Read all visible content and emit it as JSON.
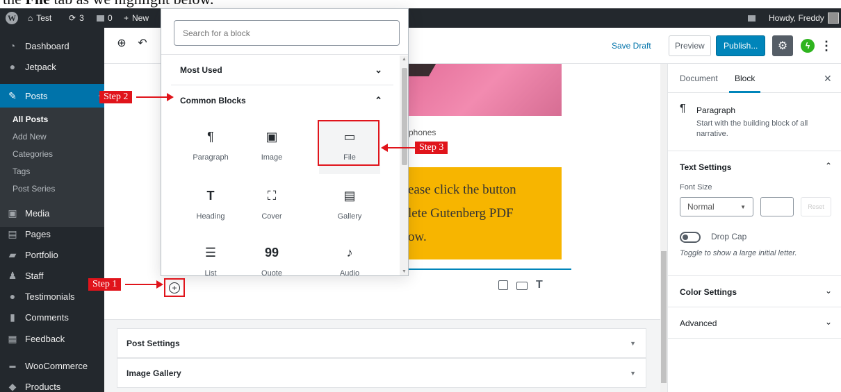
{
  "caption": {
    "prefix": "the ",
    "bold": "File",
    "suffix": " tab as we highlight below."
  },
  "adminbar": {
    "site_name": "Test",
    "updates_count": "3",
    "comments_count": "0",
    "new_label": "New",
    "howdy": "Howdy, Freddy"
  },
  "sidebar": {
    "items": [
      {
        "label": "Dashboard",
        "icon": "dashboard-icon"
      },
      {
        "label": "Jetpack",
        "icon": "jetpack-icon"
      },
      {
        "label": "Posts",
        "icon": "pin-icon"
      },
      {
        "label": "Media",
        "icon": "media-icon"
      },
      {
        "label": "Pages",
        "icon": "pages-icon"
      },
      {
        "label": "Portfolio",
        "icon": "portfolio-icon"
      },
      {
        "label": "Staff",
        "icon": "staff-icon"
      },
      {
        "label": "Testimonials",
        "icon": "testimonial-icon"
      },
      {
        "label": "Comments",
        "icon": "comments-icon"
      },
      {
        "label": "Feedback",
        "icon": "feedback-icon"
      },
      {
        "label": "WooCommerce",
        "icon": "woo-icon"
      },
      {
        "label": "Products",
        "icon": "products-icon"
      }
    ],
    "posts_sub": [
      "All Posts",
      "Add New",
      "Categories",
      "Tags",
      "Post Series"
    ]
  },
  "header": {
    "save_draft": "Save Draft",
    "preview": "Preview",
    "publish": "Publish..."
  },
  "inserter": {
    "search_placeholder": "Search for a block",
    "most_used": "Most Used",
    "common_blocks": "Common Blocks",
    "blocks": [
      {
        "label": "Paragraph",
        "icon": "paragraph-icon"
      },
      {
        "label": "Image",
        "icon": "image-icon"
      },
      {
        "label": "File",
        "icon": "folder-icon"
      },
      {
        "label": "Heading",
        "icon": "heading-icon"
      },
      {
        "label": "Cover",
        "icon": "cover-icon"
      },
      {
        "label": "Gallery",
        "icon": "gallery-icon"
      },
      {
        "label": "List",
        "icon": "list-icon"
      },
      {
        "label": "Quote",
        "icon": "quote-icon"
      },
      {
        "label": "Audio",
        "icon": "audio-icon"
      }
    ]
  },
  "content": {
    "caption_fragment": "phones",
    "yellow_lines": [
      "ease click the button",
      "lete Gutenberg PDF",
      "ow."
    ],
    "meta_boxes": [
      "Post Settings",
      "Image Gallery"
    ]
  },
  "panel": {
    "tab_document": "Document",
    "tab_block": "Block",
    "block_name": "Paragraph",
    "block_desc_1": "Start with the building block of all",
    "block_desc_2": "narrative.",
    "text_settings": "Text Settings",
    "font_size_label": "Font Size",
    "font_size_value": "Normal",
    "reset": "Reset",
    "drop_cap": "Drop Cap",
    "drop_cap_help": "Toggle to show a large initial letter.",
    "color_settings": "Color Settings",
    "advanced": "Advanced"
  },
  "annotations": {
    "step1": "Step 1",
    "step2": "Step 2",
    "step3": "Step 3"
  },
  "colors": {
    "admin_bg": "#23282d",
    "accent": "#0085ba",
    "annotation": "#e0141b",
    "highlight_yellow": "#f7b500"
  }
}
